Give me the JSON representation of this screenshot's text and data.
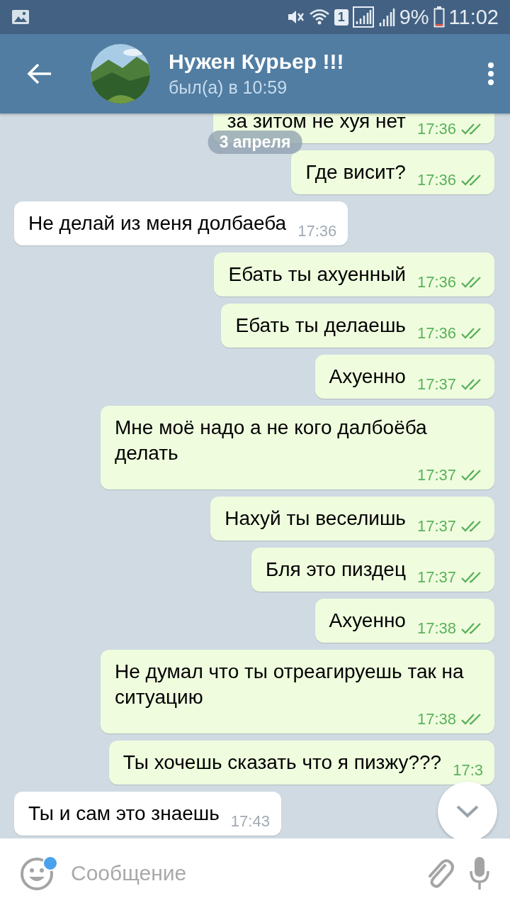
{
  "status_bar": {
    "battery_text": "9%",
    "sim_badge": "1",
    "time": "11:02"
  },
  "header": {
    "title": "Нужен Курьер !!!",
    "subtitle": "был(а) в 10:59"
  },
  "date_chip": "3 апреля",
  "messages": [
    {
      "kind": "outgoing",
      "text": "за зитом не хуя нет",
      "time": "17:36",
      "read": true
    },
    {
      "kind": "outgoing",
      "text": "Где висит?",
      "time": "17:36",
      "read": true
    },
    {
      "kind": "incoming",
      "text": "Не делай из меня долбаеба",
      "time": "17:36"
    },
    {
      "kind": "outgoing",
      "text": "Ебать ты ахуенный",
      "time": "17:36",
      "read": true
    },
    {
      "kind": "outgoing",
      "text": "Ебать ты делаешь",
      "time": "17:36",
      "read": true
    },
    {
      "kind": "outgoing",
      "text": "Ахуенно",
      "time": "17:37",
      "read": true
    },
    {
      "kind": "outgoing",
      "text": "Мне моё надо а не кого далбоёба делать",
      "time": "17:37",
      "read": true
    },
    {
      "kind": "outgoing",
      "text": "Нахуй ты веселишь",
      "time": "17:37",
      "read": true
    },
    {
      "kind": "outgoing",
      "text": "Бля это пиздец",
      "time": "17:37",
      "read": true
    },
    {
      "kind": "outgoing",
      "text": "Ахуенно",
      "time": "17:38",
      "read": true
    },
    {
      "kind": "outgoing",
      "text": "Не думал что ты отреагируешь так на ситуацию",
      "time": "17:38",
      "read": true
    },
    {
      "kind": "outgoing",
      "text": "Ты хочешь сказать что я пизжу???",
      "time": "17:3"
    },
    {
      "kind": "incoming",
      "text": "Ты и сам это знаешь",
      "time": "17:43"
    }
  ],
  "composer": {
    "placeholder": "Сообщение",
    "emoji_badge": true
  }
}
